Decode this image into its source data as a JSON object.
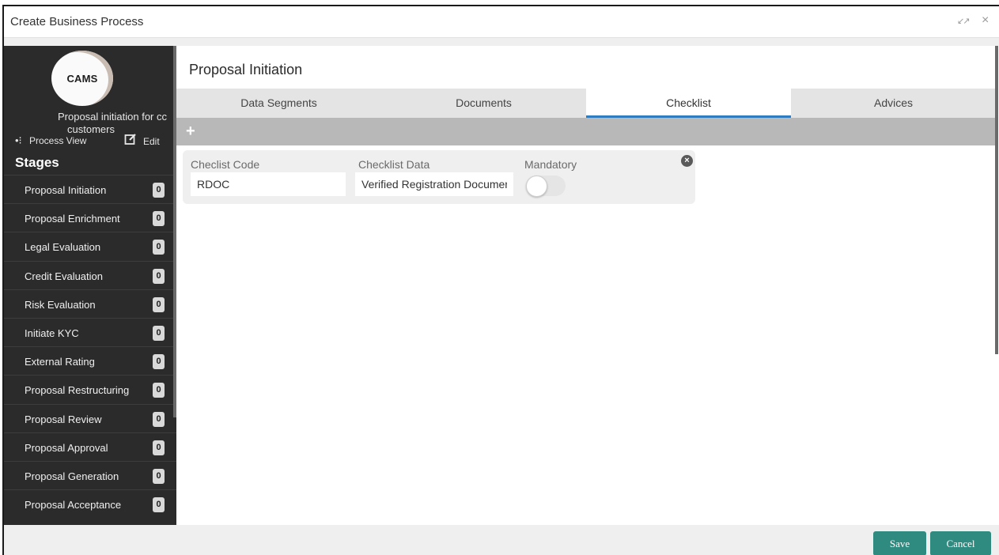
{
  "window": {
    "title": "Create Business Process",
    "minimize_icon": "↙↗",
    "close_icon": "×"
  },
  "sidebar": {
    "avatar_text": "CAMS",
    "process_name_line1": "Proposal initiation for cc",
    "process_name_line2": "customers",
    "process_view_label": "Process View",
    "edit_label": "Edit",
    "stages_title": "Stages",
    "stages": [
      {
        "label": "Proposal Initiation",
        "count": "0"
      },
      {
        "label": "Proposal Enrichment",
        "count": "0"
      },
      {
        "label": "Legal Evaluation",
        "count": "0"
      },
      {
        "label": "Credit Evaluation",
        "count": "0"
      },
      {
        "label": "Risk Evaluation",
        "count": "0"
      },
      {
        "label": "Initiate KYC",
        "count": "0"
      },
      {
        "label": "External Rating",
        "count": "0"
      },
      {
        "label": "Proposal Restructuring",
        "count": "0"
      },
      {
        "label": "Proposal Review",
        "count": "0"
      },
      {
        "label": "Proposal Approval",
        "count": "0"
      },
      {
        "label": "Proposal Generation",
        "count": "0"
      },
      {
        "label": "Proposal Acceptance",
        "count": "0"
      }
    ]
  },
  "main": {
    "page_title": "Proposal Initiation",
    "tabs": [
      {
        "label": "Data Segments"
      },
      {
        "label": "Documents"
      },
      {
        "label": "Checklist"
      },
      {
        "label": "Advices"
      }
    ],
    "active_tab": "Checklist",
    "add_icon": "+",
    "checklist": {
      "code_label": "Checlist Code",
      "code_value": "RDOC",
      "data_label": "Checklist Data",
      "data_value": "Verified Registration Documen",
      "mandatory_label": "Mandatory",
      "mandatory_on": false,
      "remove_icon": "×"
    }
  },
  "footer": {
    "save_label": "Save",
    "cancel_label": "Cancel"
  },
  "colors": {
    "sidebar_bg": "#2b2b2b",
    "accent_tab": "#2f7dc0",
    "button": "#2f8a7f",
    "toolbar": "#b8b8b8"
  }
}
